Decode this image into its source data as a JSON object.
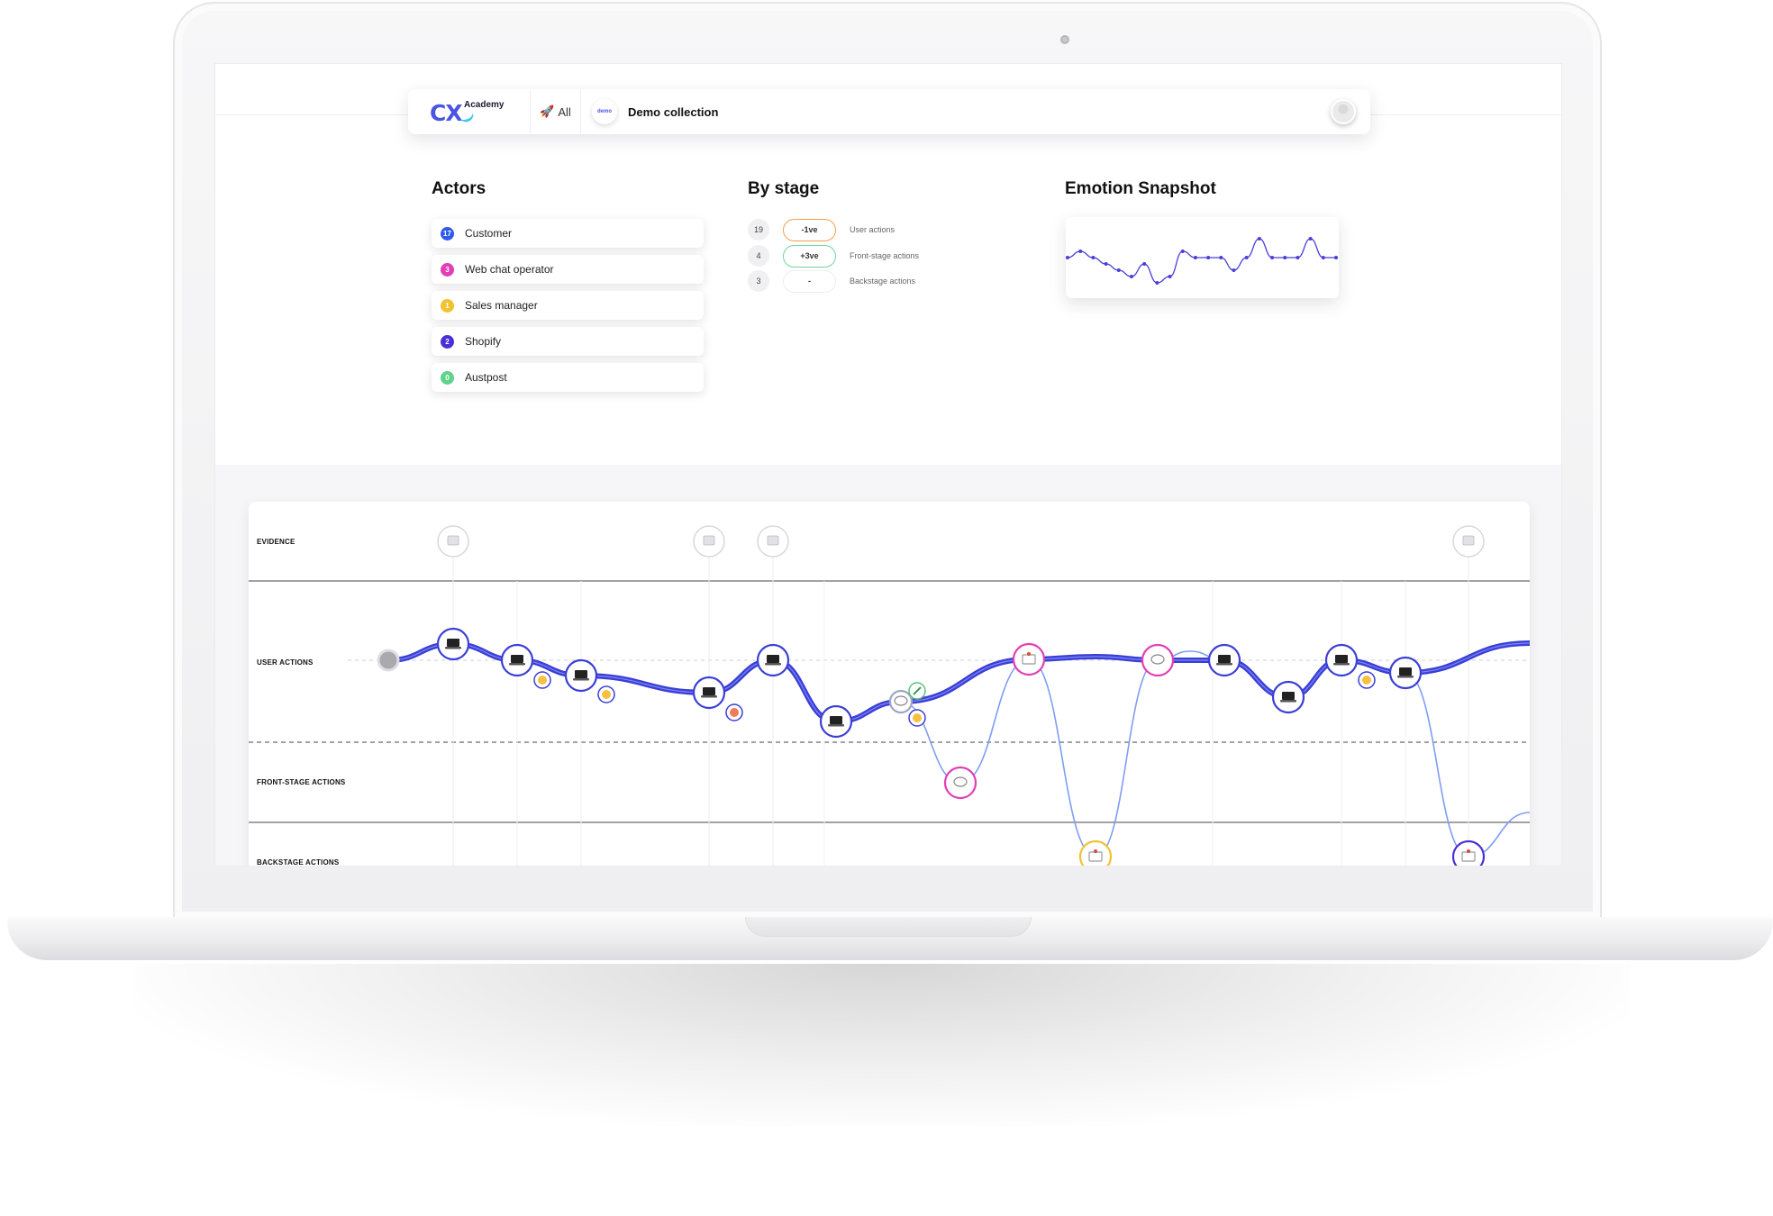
{
  "header": {
    "logo_main": "CX",
    "logo_sub": "Academy",
    "filter_icon": "rocket-icon",
    "filter_label": "All",
    "collection_badge": "demo",
    "collection_name": "Demo collection",
    "avatar_icon": "user-avatar-icon"
  },
  "actors": {
    "title": "Actors",
    "items": [
      {
        "count": "17",
        "name": "Customer",
        "color": "#2f5bea"
      },
      {
        "count": "3",
        "name": "Web chat operator",
        "color": "#e03fb5"
      },
      {
        "count": "1",
        "name": "Sales manager",
        "color": "#f2c230"
      },
      {
        "count": "2",
        "name": "Shopify",
        "color": "#4a2fd6"
      },
      {
        "count": "0",
        "name": "Austpost",
        "color": "#5fd38a"
      }
    ]
  },
  "by_stage": {
    "title": "By stage",
    "rows": [
      {
        "count": "19",
        "sentiment": "-1ve",
        "label": "User actions",
        "pill_color": "#f5a04a"
      },
      {
        "count": "4",
        "sentiment": "+3ve",
        "label": "Front-stage actions",
        "pill_color": "#6fd49a"
      },
      {
        "count": "3",
        "sentiment": "-",
        "label": "Backstage actions",
        "pill_color": "#eeeeee"
      }
    ]
  },
  "emotion_snapshot": {
    "title": "Emotion Snapshot",
    "line_color": "#4a3fd6",
    "values": [
      0,
      1,
      0,
      -1,
      -2,
      -3,
      -1,
      -4,
      -3,
      1,
      0,
      0,
      0,
      -2,
      0,
      3,
      0,
      0,
      0,
      3,
      0,
      0
    ]
  },
  "journey": {
    "rows": [
      "EVIDENCE",
      "USER ACTIONS",
      "FRONT-STAGE ACTIONS",
      "BACKSTAGE ACTIONS"
    ],
    "colors": {
      "customer": "#3b3fd6",
      "operator": "#e03fb5",
      "sales": "#f2c230",
      "shopify": "#4a2fd6",
      "thin_line": "#7f9ef2"
    }
  }
}
